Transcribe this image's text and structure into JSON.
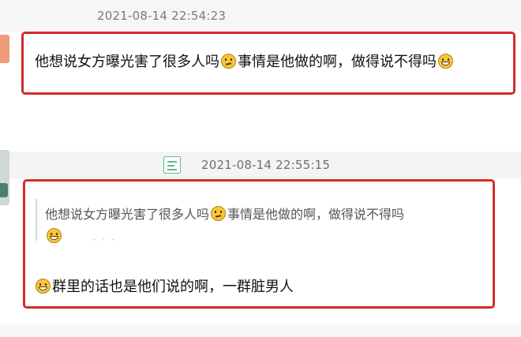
{
  "comment1": {
    "timestamp": "2021-08-14 22:54:23",
    "text_part1": "他想说女方曝光害了很多人吗",
    "emoji1": "thinking-face-icon",
    "text_part2": "事情是他做的啊，做得说不得吗",
    "emoji2": "laughing-face-icon"
  },
  "comment2": {
    "timestamp": "2021-08-14 22:55:15",
    "quote": {
      "text_part1": "他想说女方曝光害了很多人吗",
      "emoji1": "thinking-face-icon",
      "text_part2": "事情是他做的啊，做得说不得吗",
      "emoji2": "laughing-face-icon"
    },
    "reply_emoji": "laughing-face-icon",
    "reply_text": "群里的话也是他们说的啊，一群脏男人"
  },
  "colors": {
    "highlight_border": "#d42b2b",
    "timestamp": "#7a7a7a",
    "emoji": "#f6c53c",
    "list_icon": "#63b88a"
  }
}
